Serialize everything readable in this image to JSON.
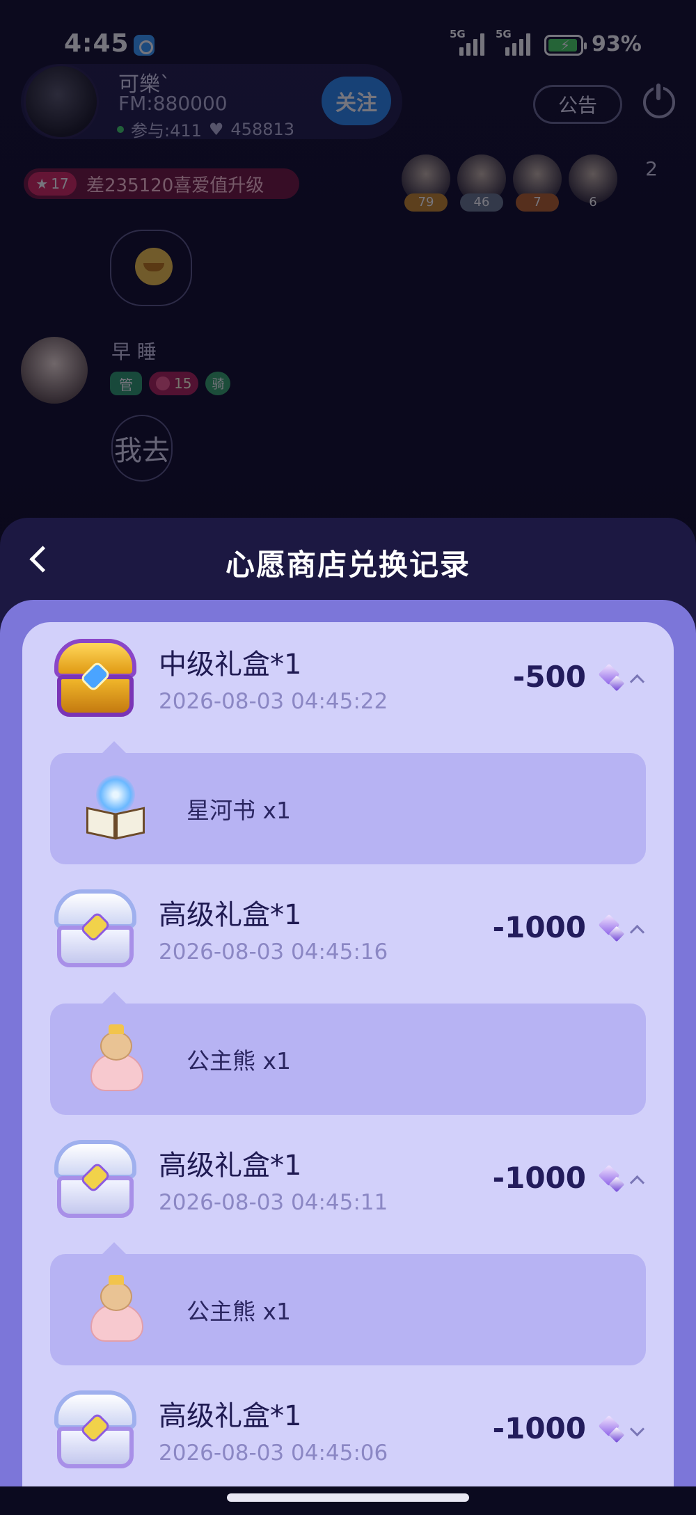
{
  "status_bar": {
    "time": "4:45",
    "signal_1_label": "5G",
    "signal_2_label": "5G",
    "battery_percent": "93%",
    "battery_level": 0.93
  },
  "room": {
    "host": {
      "name": "可樂`",
      "fm": "FM:880000",
      "participants": "参与:411",
      "likes": "458813"
    },
    "follow_label": "关注",
    "notice_label": "公告",
    "level_badge": "17",
    "level_text": "差235120喜爱值升级",
    "audience": [
      {
        "count": "79"
      },
      {
        "count": "46"
      },
      {
        "count": "7"
      },
      {
        "count": "6"
      }
    ],
    "audience_more": "2",
    "chat": {
      "user_name": "早 睡",
      "admin_badge": "管",
      "level": "15",
      "extra_badge": "骑",
      "message": "我去"
    }
  },
  "sheet": {
    "title": "心愿商店兑换记录"
  },
  "records": [
    {
      "title": "中级礼盒*1",
      "time": "2026-08-03 04:45:22",
      "amount": "-500",
      "chest": "gold-chest",
      "expanded": true,
      "reward": {
        "label": "星河书 x1",
        "icon": "star-river-book"
      }
    },
    {
      "title": "高级礼盒*1",
      "time": "2026-08-03 04:45:16",
      "amount": "-1000",
      "chest": "silver-chest",
      "expanded": true,
      "reward": {
        "label": "公主熊 x1",
        "icon": "princess-bear"
      }
    },
    {
      "title": "高级礼盒*1",
      "time": "2026-08-03 04:45:11",
      "amount": "-1000",
      "chest": "silver-chest",
      "expanded": true,
      "reward": {
        "label": "公主熊 x1",
        "icon": "princess-bear"
      }
    },
    {
      "title": "高级礼盒*1",
      "time": "2026-08-03 04:45:06",
      "amount": "-1000",
      "chest": "silver-chest",
      "expanded": false
    }
  ]
}
